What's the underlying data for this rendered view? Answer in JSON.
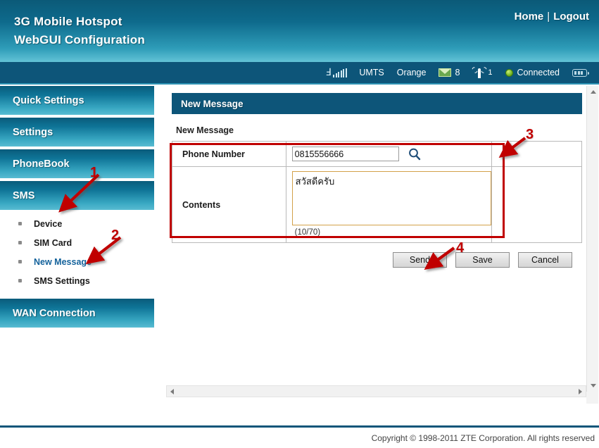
{
  "header": {
    "title_line1": "3G Mobile Hotspot",
    "title_line2": "WebGUI Configuration",
    "home_label": "Home",
    "separator": "|",
    "logout_label": "Logout"
  },
  "statusbar": {
    "signal_icon": "signal-bars-icon",
    "network_mode": "UMTS",
    "carrier": "Orange",
    "mail_icon": "envelope-icon",
    "sms_count": "8",
    "tower_icon": "cell-tower-icon",
    "tower_count": "1",
    "connection_dot": "green-status-dot",
    "connection_status": "Connected",
    "battery_icon": "battery-icon"
  },
  "sidebar": {
    "items": [
      {
        "label": "Quick Settings"
      },
      {
        "label": "Settings"
      },
      {
        "label": "PhoneBook"
      },
      {
        "label": "SMS"
      },
      {
        "label": "WAN Connection"
      }
    ],
    "sms_sub_items": [
      {
        "label": "Device",
        "active": false
      },
      {
        "label": "SIM Card",
        "active": false
      },
      {
        "label": "New Message",
        "active": true
      },
      {
        "label": "SMS Settings",
        "active": false
      }
    ]
  },
  "main": {
    "panel_title": "New Message",
    "section_label": "New Message",
    "fields": {
      "phone_label": "Phone Number",
      "phone_value": "0815556666",
      "phone_placeholder": "",
      "search_icon": "magnifier-icon",
      "contents_label": "Contents",
      "contents_value": "สวัสดีครับ",
      "contents_placeholder": "",
      "counter": "(10/70)"
    },
    "buttons": {
      "send": "Send",
      "save": "Save",
      "cancel": "Cancel"
    }
  },
  "annotations": {
    "markers": [
      {
        "id": "1",
        "target": "sms-nav-item"
      },
      {
        "id": "2",
        "target": "new-message-sub-item"
      },
      {
        "id": "3",
        "target": "form-fields-region"
      },
      {
        "id": "4",
        "target": "send-button"
      }
    ],
    "color": "#c00000"
  },
  "footer": {
    "copyright": "Copyright © 1998-2011 ZTE Corporation. All rights reserved"
  },
  "colors": {
    "header_top": "#0b5a78",
    "header_bottom": "#63c3d6",
    "panel_header": "#0d5579",
    "accent_link": "#14629b",
    "annotation_red": "#c00000",
    "textarea_border": "#d3a14a",
    "status_green": "#7dbb2a"
  }
}
